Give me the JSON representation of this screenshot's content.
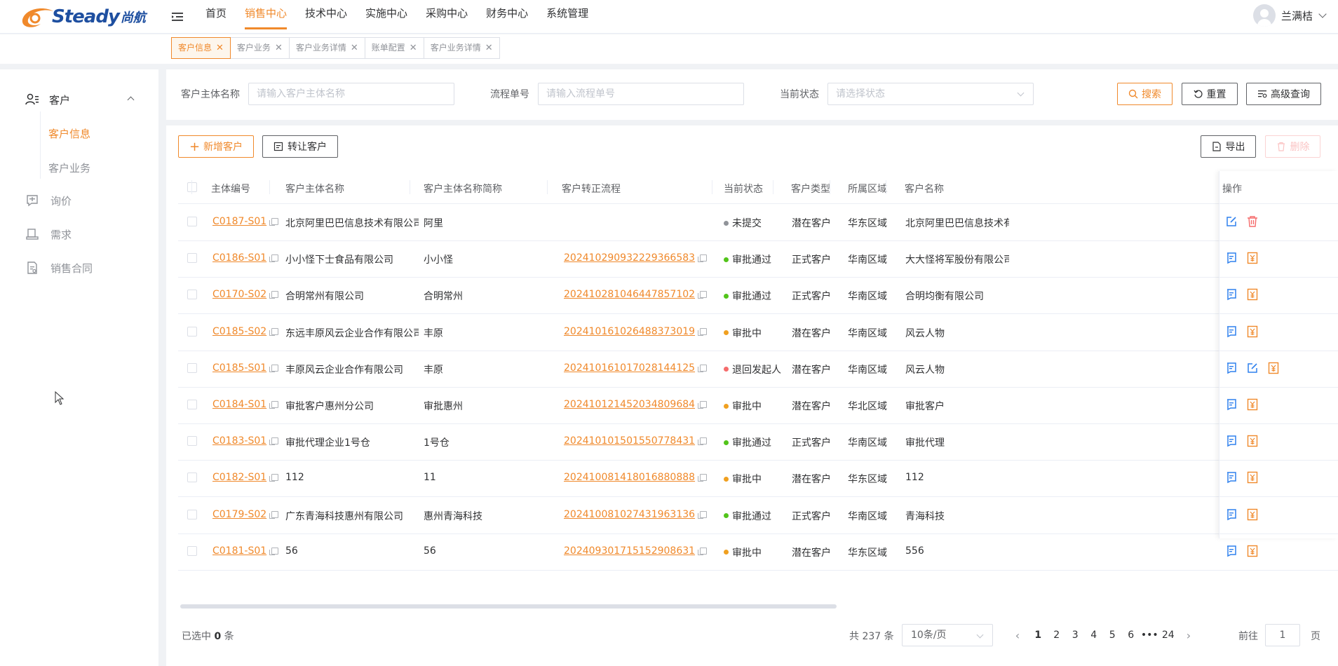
{
  "brand": {
    "logo_text": "Steady",
    "logo_cn": "尚航"
  },
  "nav": [
    "首页",
    "销售中心",
    "技术中心",
    "实施中心",
    "采购中心",
    "财务中心",
    "系统管理"
  ],
  "nav_active": 1,
  "user": {
    "name": "兰满桔"
  },
  "tabs": [
    "客户信息",
    "客户业务",
    "客户业务详情",
    "账单配置",
    "客户业务详情"
  ],
  "tab_active": 0,
  "sidebar": {
    "group": "客户",
    "subs": [
      "客户信息",
      "客户业务"
    ],
    "items": [
      "询价",
      "需求",
      "销售合同"
    ]
  },
  "search": {
    "f1_label": "客户主体名称",
    "f1_placeholder": "请输入客户主体名称",
    "f2_label": "流程单号",
    "f2_placeholder": "请输入流程单号",
    "f3_label": "当前状态",
    "f3_placeholder": "请选择状态",
    "search_btn": "搜索",
    "reset_btn": "重置",
    "advanced_btn": "高级查询"
  },
  "toolbar": {
    "add_btn": "新增客户",
    "transfer_btn": "转让客户",
    "export_btn": "导出",
    "delete_btn": "删除"
  },
  "columns": [
    "主体编号",
    "客户主体名称",
    "客户主体名称简称",
    "客户转正流程",
    "当前状态",
    "客户类型",
    "所属区域",
    "客户名称",
    "操作"
  ],
  "status_colors": {
    "未提交": "#909399",
    "审批通过": "#52c41a",
    "审批中": "#f0a020",
    "退回发起人": "#f56c6c"
  },
  "accent": "#f0892b",
  "rows": [
    {
      "code": "C0187-S01",
      "name": "北京阿里巴巴信息技术有限公司",
      "short": "阿里",
      "flow": "",
      "status": "未提交",
      "type": "潜在客户",
      "region": "华东区域",
      "cust": "北京阿里巴巴信息技术有限公司",
      "ops": [
        "edit",
        "delete"
      ]
    },
    {
      "code": "C0186-S01",
      "name": "小小怪下士食品有限公司",
      "short": "小小怪",
      "flow": "20241029093222936658​3",
      "status": "审批通过",
      "type": "正式客户",
      "region": "华南区域",
      "cust": "大大怪将军股份有限公司",
      "ops": [
        "view",
        "bill"
      ]
    },
    {
      "code": "C0170-S02",
      "name": "合明常州有限公司",
      "short": "合明常州",
      "flow": "20241028104644785710​2",
      "status": "审批通过",
      "type": "正式客户",
      "region": "华南区域",
      "cust": "合明均衡有限公司",
      "ops": [
        "view",
        "bill"
      ]
    },
    {
      "code": "C0185-S02",
      "name": "东远丰原风云企业合作有限公司",
      "short": "丰原",
      "flow": "20241016102648837301​9",
      "status": "审批中",
      "type": "潜在客户",
      "region": "华南区域",
      "cust": "风云人物",
      "ops": [
        "view",
        "bill"
      ]
    },
    {
      "code": "C0185-S01",
      "name": "丰原风云企业合作有限公司",
      "short": "丰原",
      "flow": "20241016101702814412​5",
      "status": "退回发起人",
      "type": "潜在客户",
      "region": "华南区域",
      "cust": "风云人物",
      "ops": [
        "view",
        "edit",
        "bill"
      ]
    },
    {
      "code": "C0184-S01",
      "name": "审批客户惠州分公司",
      "short": "审批惠州",
      "flow": "20241012145203480968​4",
      "status": "审批中",
      "type": "潜在客户",
      "region": "华北区域",
      "cust": "审批客户",
      "ops": [
        "view",
        "bill"
      ]
    },
    {
      "code": "C0183-S01",
      "name": "审批代理企业1号仓",
      "short": "1号仓",
      "flow": "20241010150155077843​1",
      "status": "审批通过",
      "type": "正式客户",
      "region": "华南区域",
      "cust": "审批代理",
      "ops": [
        "view",
        "bill"
      ]
    },
    {
      "code": "C0182-S01",
      "name": "112",
      "short": "11",
      "flow": "20241008141801688088​8",
      "status": "审批中",
      "type": "潜在客户",
      "region": "华东区域",
      "cust": "112",
      "ops": [
        "view",
        "bill"
      ]
    },
    {
      "code": "C0179-S02",
      "name": "广东青海科技惠州有限公司",
      "short": "惠州青海科技",
      "flow": "20241008102743196313​6",
      "status": "审批通过",
      "type": "正式客户",
      "region": "华南区域",
      "cust": "青海科技",
      "ops": [
        "view",
        "bill"
      ]
    },
    {
      "code": "C0181-S01",
      "name": "56",
      "short": "56",
      "flow": "20240930171515290863​1",
      "status": "审批中",
      "type": "潜在客户",
      "region": "华东区域",
      "cust": "556",
      "ops": [
        "view",
        "bill"
      ]
    }
  ],
  "footer": {
    "selected_prefix": "已选中",
    "selected_count": "0",
    "selected_suffix": "条",
    "total": "共 237 条",
    "page_size": "10条/页",
    "pages": [
      "1",
      "2",
      "3",
      "4",
      "5",
      "6",
      "•••",
      "24"
    ],
    "current_page": "1",
    "goto_label": "前往",
    "goto_value": "1",
    "goto_suffix": "页"
  }
}
